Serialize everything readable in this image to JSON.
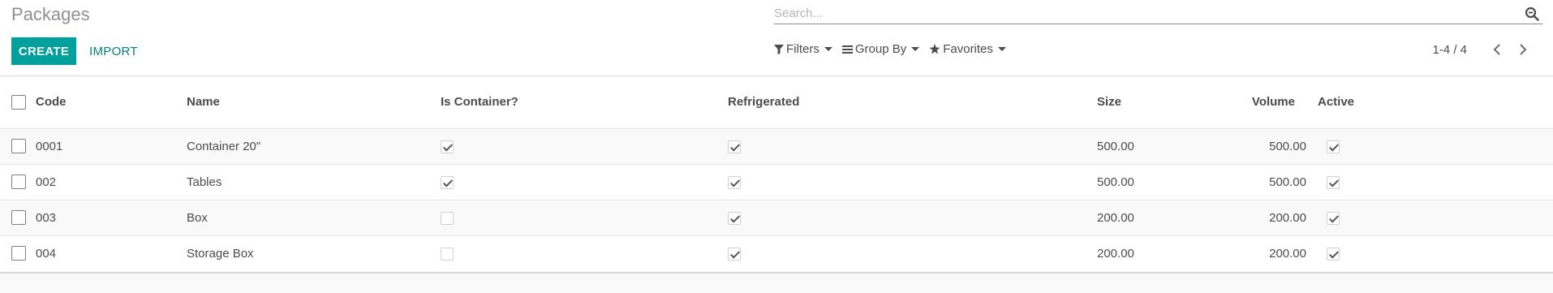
{
  "page": {
    "title": "Packages"
  },
  "search": {
    "placeholder": "Search..."
  },
  "toolbar": {
    "create_label": "CREATE",
    "import_label": "IMPORT"
  },
  "search_options": {
    "filters": "Filters",
    "group_by": "Group By",
    "favorites": "Favorites"
  },
  "pager": {
    "value": "1-4 / 4"
  },
  "table": {
    "headers": {
      "code": "Code",
      "name": "Name",
      "is_container": "Is Container?",
      "refrigerated": "Refrigerated",
      "size": "Size",
      "volume": "Volume",
      "active": "Active"
    },
    "rows": [
      {
        "code": "0001",
        "name": "Container 20\"",
        "is_container": true,
        "refrigerated": true,
        "size": "500.00",
        "volume": "500.00",
        "active": true
      },
      {
        "code": "002",
        "name": "Tables",
        "is_container": true,
        "refrigerated": true,
        "size": "500.00",
        "volume": "500.00",
        "active": true
      },
      {
        "code": "003",
        "name": "Box",
        "is_container": false,
        "refrigerated": true,
        "size": "200.00",
        "volume": "200.00",
        "active": true
      },
      {
        "code": "004",
        "name": "Storage Box",
        "is_container": false,
        "refrigerated": true,
        "size": "200.00",
        "volume": "200.00",
        "active": true
      }
    ]
  },
  "colors": {
    "primary": "#00a09d",
    "link": "#00807d"
  }
}
